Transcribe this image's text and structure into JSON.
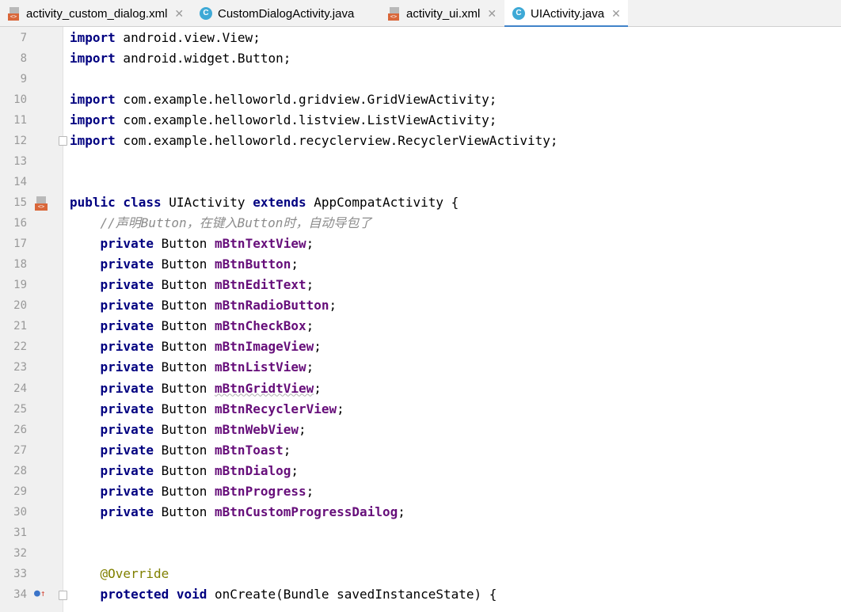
{
  "tabs": [
    {
      "label": "activity_custom_dialog.xml",
      "icon": "xml-file-icon",
      "closable": true,
      "active": false
    },
    {
      "label": "CustomDialogActivity.java",
      "icon": "java-class-icon",
      "closable": false,
      "active": false
    },
    {
      "label": "activity_ui.xml",
      "icon": "xml-file-icon",
      "closable": true,
      "active": false
    },
    {
      "label": "UIActivity.java",
      "icon": "java-class-icon",
      "closable": true,
      "active": true
    }
  ],
  "gutter_icons": {
    "line15": "xml-layout-icon",
    "line34": "override-method-icon"
  },
  "code_lines": [
    {
      "n": "7",
      "segments": [
        {
          "t": "import",
          "c": "kw"
        },
        {
          "t": " android.view.View;",
          "c": ""
        }
      ]
    },
    {
      "n": "8",
      "segments": [
        {
          "t": "import",
          "c": "kw"
        },
        {
          "t": " android.widget.Button;",
          "c": ""
        }
      ]
    },
    {
      "n": "9",
      "segments": []
    },
    {
      "n": "10",
      "segments": [
        {
          "t": "import",
          "c": "kw"
        },
        {
          "t": " com.example.helloworld.gridview.GridViewActivity;",
          "c": ""
        }
      ]
    },
    {
      "n": "11",
      "segments": [
        {
          "t": "import",
          "c": "kw"
        },
        {
          "t": " com.example.helloworld.listview.ListViewActivity;",
          "c": ""
        }
      ]
    },
    {
      "n": "12",
      "segments": [
        {
          "t": "import",
          "c": "kw"
        },
        {
          "t": " com.example.helloworld.recyclerview.RecyclerViewActivity;",
          "c": ""
        }
      ]
    },
    {
      "n": "13",
      "segments": []
    },
    {
      "n": "14",
      "segments": []
    },
    {
      "n": "15",
      "segments": [
        {
          "t": "public class",
          "c": "kw"
        },
        {
          "t": " UIActivity ",
          "c": ""
        },
        {
          "t": "extends",
          "c": "kw"
        },
        {
          "t": " AppCompatActivity {",
          "c": ""
        }
      ]
    },
    {
      "n": "16",
      "segments": [
        {
          "t": "    ",
          "c": ""
        },
        {
          "t": "//声明Button，在键入Button时，自动导包了",
          "c": "comment"
        }
      ]
    },
    {
      "n": "17",
      "segments": [
        {
          "t": "    ",
          "c": ""
        },
        {
          "t": "private",
          "c": "kw"
        },
        {
          "t": " Button ",
          "c": ""
        },
        {
          "t": "mBtnTextView",
          "c": "field"
        },
        {
          "t": ";",
          "c": ""
        }
      ]
    },
    {
      "n": "18",
      "segments": [
        {
          "t": "    ",
          "c": ""
        },
        {
          "t": "private",
          "c": "kw"
        },
        {
          "t": " Button ",
          "c": ""
        },
        {
          "t": "mBtnButton",
          "c": "field"
        },
        {
          "t": ";",
          "c": ""
        }
      ]
    },
    {
      "n": "19",
      "segments": [
        {
          "t": "    ",
          "c": ""
        },
        {
          "t": "private",
          "c": "kw"
        },
        {
          "t": " Button ",
          "c": ""
        },
        {
          "t": "mBtnEditText",
          "c": "field"
        },
        {
          "t": ";",
          "c": ""
        }
      ]
    },
    {
      "n": "20",
      "segments": [
        {
          "t": "    ",
          "c": ""
        },
        {
          "t": "private",
          "c": "kw"
        },
        {
          "t": " Button ",
          "c": ""
        },
        {
          "t": "mBtnRadioButton",
          "c": "field"
        },
        {
          "t": ";",
          "c": ""
        }
      ]
    },
    {
      "n": "21",
      "segments": [
        {
          "t": "    ",
          "c": ""
        },
        {
          "t": "private",
          "c": "kw"
        },
        {
          "t": " Button ",
          "c": ""
        },
        {
          "t": "mBtnCheckBox",
          "c": "field"
        },
        {
          "t": ";",
          "c": ""
        }
      ]
    },
    {
      "n": "22",
      "segments": [
        {
          "t": "    ",
          "c": ""
        },
        {
          "t": "private",
          "c": "kw"
        },
        {
          "t": " Button ",
          "c": ""
        },
        {
          "t": "mBtnImageView",
          "c": "field"
        },
        {
          "t": ";",
          "c": ""
        }
      ]
    },
    {
      "n": "23",
      "segments": [
        {
          "t": "    ",
          "c": ""
        },
        {
          "t": "private",
          "c": "kw"
        },
        {
          "t": " Button ",
          "c": ""
        },
        {
          "t": "mBtnListView",
          "c": "field"
        },
        {
          "t": ";",
          "c": ""
        }
      ]
    },
    {
      "n": "24",
      "segments": [
        {
          "t": "    ",
          "c": ""
        },
        {
          "t": "private",
          "c": "kw"
        },
        {
          "t": " Button ",
          "c": ""
        },
        {
          "t": "mBtnGridtView",
          "c": "field squiggle"
        },
        {
          "t": ";",
          "c": ""
        }
      ]
    },
    {
      "n": "25",
      "segments": [
        {
          "t": "    ",
          "c": ""
        },
        {
          "t": "private",
          "c": "kw"
        },
        {
          "t": " Button ",
          "c": ""
        },
        {
          "t": "mBtnRecyclerView",
          "c": "field"
        },
        {
          "t": ";",
          "c": ""
        }
      ]
    },
    {
      "n": "26",
      "segments": [
        {
          "t": "    ",
          "c": ""
        },
        {
          "t": "private",
          "c": "kw"
        },
        {
          "t": " Button ",
          "c": ""
        },
        {
          "t": "mBtnWebView",
          "c": "field"
        },
        {
          "t": ";",
          "c": ""
        }
      ]
    },
    {
      "n": "27",
      "segments": [
        {
          "t": "    ",
          "c": ""
        },
        {
          "t": "private",
          "c": "kw"
        },
        {
          "t": " Button ",
          "c": ""
        },
        {
          "t": "mBtnToast",
          "c": "field"
        },
        {
          "t": ";",
          "c": ""
        }
      ]
    },
    {
      "n": "28",
      "segments": [
        {
          "t": "    ",
          "c": ""
        },
        {
          "t": "private",
          "c": "kw"
        },
        {
          "t": " Button ",
          "c": ""
        },
        {
          "t": "mBtnDialog",
          "c": "field"
        },
        {
          "t": ";",
          "c": ""
        }
      ]
    },
    {
      "n": "29",
      "segments": [
        {
          "t": "    ",
          "c": ""
        },
        {
          "t": "private",
          "c": "kw"
        },
        {
          "t": " Button ",
          "c": ""
        },
        {
          "t": "mBtnProgress",
          "c": "field"
        },
        {
          "t": ";",
          "c": ""
        }
      ]
    },
    {
      "n": "30",
      "segments": [
        {
          "t": "    ",
          "c": ""
        },
        {
          "t": "private",
          "c": "kw"
        },
        {
          "t": " Button ",
          "c": ""
        },
        {
          "t": "mBtnCustomProgressDailog",
          "c": "field"
        },
        {
          "t": ";",
          "c": ""
        }
      ]
    },
    {
      "n": "31",
      "segments": []
    },
    {
      "n": "32",
      "segments": []
    },
    {
      "n": "33",
      "segments": [
        {
          "t": "    ",
          "c": ""
        },
        {
          "t": "@Override",
          "c": "annot"
        }
      ]
    },
    {
      "n": "34",
      "segments": [
        {
          "t": "    ",
          "c": ""
        },
        {
          "t": "protected void",
          "c": "kw"
        },
        {
          "t": " onCreate(Bundle savedInstanceState) {",
          "c": ""
        }
      ]
    }
  ],
  "colors": {
    "keyword": "#000080",
    "field": "#660e7a",
    "comment": "#8c8c8c",
    "annotation": "#808000",
    "active_tab_underline": "#4083c9"
  }
}
